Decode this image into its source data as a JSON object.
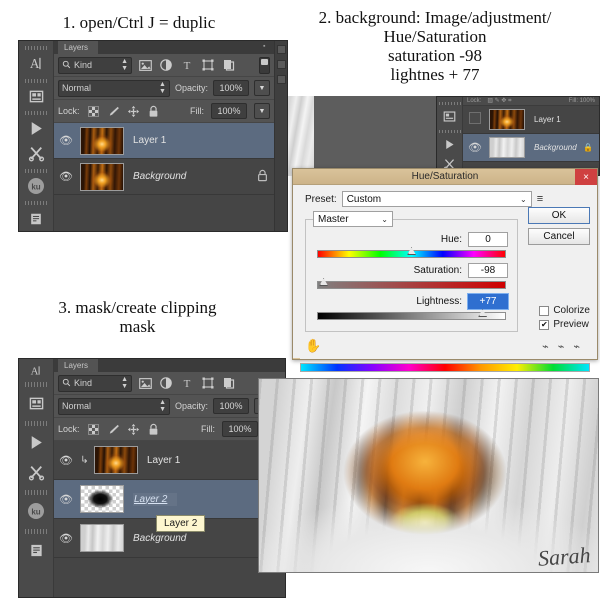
{
  "captions": {
    "step1": "1. open/Ctrl J = duplic",
    "step2": "2. background: Image/adjustment/\nHue/Saturation\nsaturation -98\nlightnes + 77",
    "step3": "3. mask/create clipping\nmask"
  },
  "panel1": {
    "tab_label": "Layers",
    "filter": {
      "search_icon": "search-icon",
      "kind_label": "Kind",
      "icons": [
        "image-filter-icon",
        "adjustment-filter-icon",
        "type-filter-icon",
        "shape-filter-icon",
        "smart-object-filter-icon"
      ],
      "toggle": "filter-toggle"
    },
    "blend": {
      "mode": "Normal",
      "opacity_label": "Opacity:",
      "opacity_value": "100%"
    },
    "lock": {
      "label": "Lock:",
      "fill_label": "Fill:",
      "fill_value": "100%"
    },
    "layers": [
      {
        "name": "Layer 1",
        "visible": true,
        "selected": true,
        "locked": false,
        "thumb": "forest"
      },
      {
        "name": "Background",
        "visible": true,
        "selected": false,
        "locked": true,
        "thumb": "forest"
      }
    ]
  },
  "panel2": {
    "layers": [
      {
        "name": "Layer 1",
        "visible": false,
        "selected": false,
        "locked": false,
        "thumb": "forest"
      },
      {
        "name": "Background",
        "visible": true,
        "selected": true,
        "locked": true,
        "thumb": "gray"
      }
    ]
  },
  "panel3": {
    "tab_label": "Layers",
    "filter": {
      "kind_label": "Kind"
    },
    "blend": {
      "mode": "Normal",
      "opacity_label": "Opacity:",
      "opacity_value": "100%"
    },
    "lock": {
      "label": "Lock:",
      "fill_label": "Fill:",
      "fill_value": "100%"
    },
    "layers": [
      {
        "name": "Layer 1",
        "visible": true,
        "selected": false,
        "locked": false,
        "thumb": "forest",
        "clipped": true
      },
      {
        "name": "Layer 2",
        "visible": true,
        "selected": true,
        "locked": false,
        "thumb": "mask",
        "editing": true
      },
      {
        "name": "Background",
        "visible": true,
        "selected": false,
        "locked": true,
        "thumb": "gray"
      }
    ],
    "tooltip": "Layer 2"
  },
  "dialog": {
    "title": "Hue/Saturation",
    "close_label": "×",
    "preset_label": "Preset:",
    "preset_value": "Custom",
    "preset_menu_icon": "preset-menu-icon",
    "ok_label": "OK",
    "cancel_label": "Cancel",
    "channel_value": "Master",
    "sliders": [
      {
        "name": "Hue:",
        "value": "0",
        "handle_pct": 50,
        "selected": false
      },
      {
        "name": "Saturation:",
        "value": "-98",
        "handle_pct": 2,
        "selected": false
      },
      {
        "name": "Lightness:",
        "value": "+77",
        "handle_pct": 88,
        "selected": true
      }
    ],
    "hand_icon": "hand-icon",
    "eyedroppers": [
      "eyedropper-icon",
      "eyedropper-add-icon",
      "eyedropper-subtract-icon"
    ],
    "colorize_label": "Colorize",
    "colorize_checked": false,
    "preview_label": "Preview",
    "preview_checked": true
  },
  "result": {
    "signature": "Sarah"
  },
  "toolbar_icons": [
    "text-tool-icon",
    "panel-tool-icon",
    "play-tool-icon",
    "scissors-tool-icon",
    "ku-badge-icon",
    "notes-tool-icon"
  ],
  "colors": {
    "panel_bg": "#535353",
    "layer_bg": "#454545",
    "selection": "#5c6b80",
    "dialog_title": "#cdb489",
    "tooltip": "#fdf6cf",
    "accent_blue": "#2f6fd0"
  }
}
